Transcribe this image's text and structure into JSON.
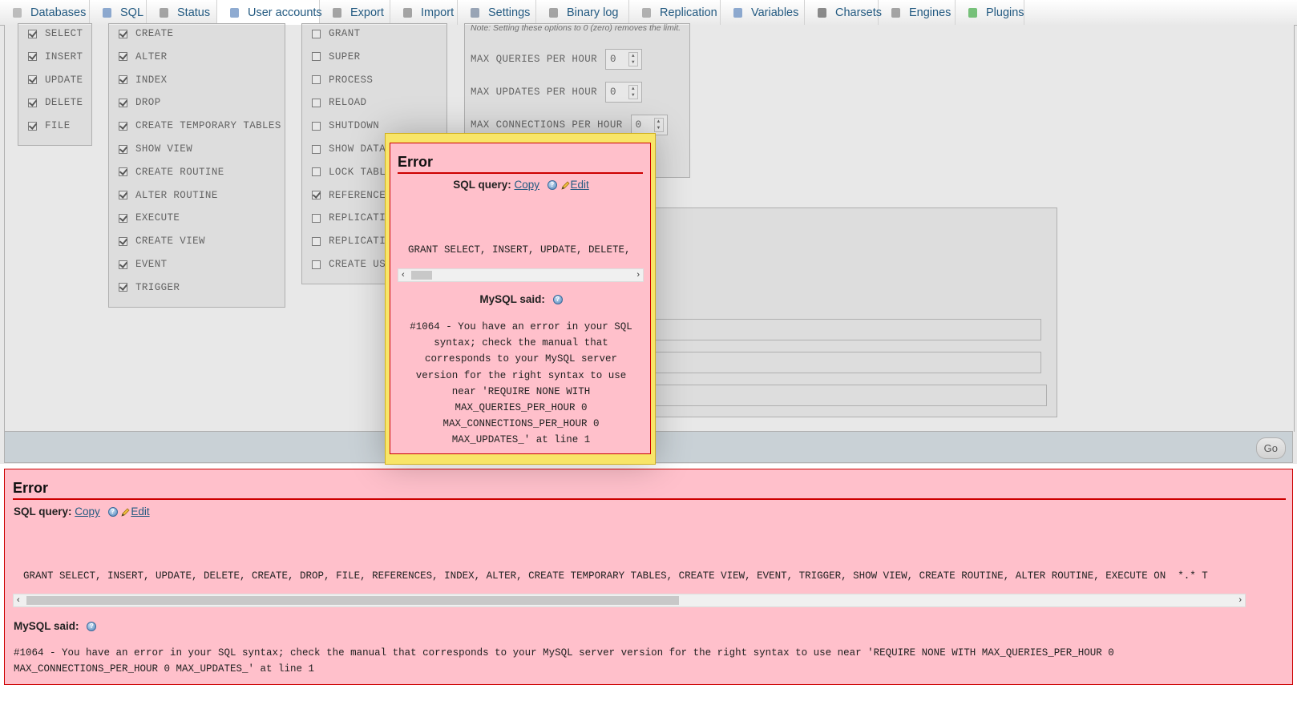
{
  "tabs": [
    {
      "label": "Databases",
      "icon": "database-icon",
      "active": false
    },
    {
      "label": "SQL",
      "icon": "sql-icon",
      "active": false
    },
    {
      "label": "Status",
      "icon": "status-icon",
      "active": false
    },
    {
      "label": "User accounts",
      "icon": "users-icon",
      "active": true
    },
    {
      "label": "Export",
      "icon": "export-icon",
      "active": false
    },
    {
      "label": "Import",
      "icon": "import-icon",
      "active": false
    },
    {
      "label": "Settings",
      "icon": "settings-icon",
      "active": false
    },
    {
      "label": "Binary log",
      "icon": "binary-log-icon",
      "active": false
    },
    {
      "label": "Replication",
      "icon": "replication-icon",
      "active": false
    },
    {
      "label": "Variables",
      "icon": "variables-icon",
      "active": false
    },
    {
      "label": "Charsets",
      "icon": "charsets-icon",
      "active": false
    },
    {
      "label": "Engines",
      "icon": "engines-icon",
      "active": false
    },
    {
      "label": "Plugins",
      "icon": "plugins-icon",
      "active": false
    }
  ],
  "privileges": {
    "data": [
      {
        "label": "SELECT",
        "checked": true
      },
      {
        "label": "INSERT",
        "checked": true
      },
      {
        "label": "UPDATE",
        "checked": true
      },
      {
        "label": "DELETE",
        "checked": true
      },
      {
        "label": "FILE",
        "checked": true
      }
    ],
    "structure": [
      {
        "label": "CREATE",
        "checked": true
      },
      {
        "label": "ALTER",
        "checked": true
      },
      {
        "label": "INDEX",
        "checked": true
      },
      {
        "label": "DROP",
        "checked": true
      },
      {
        "label": "CREATE TEMPORARY TABLES",
        "checked": true
      },
      {
        "label": "SHOW VIEW",
        "checked": true
      },
      {
        "label": "CREATE ROUTINE",
        "checked": true
      },
      {
        "label": "ALTER ROUTINE",
        "checked": true
      },
      {
        "label": "EXECUTE",
        "checked": true
      },
      {
        "label": "CREATE VIEW",
        "checked": true
      },
      {
        "label": "EVENT",
        "checked": true
      },
      {
        "label": "TRIGGER",
        "checked": true
      }
    ],
    "administration": [
      {
        "label": "GRANT",
        "checked": false
      },
      {
        "label": "SUPER",
        "checked": false
      },
      {
        "label": "PROCESS",
        "checked": false
      },
      {
        "label": "RELOAD",
        "checked": false
      },
      {
        "label": "SHUTDOWN",
        "checked": false
      },
      {
        "label": "SHOW DATA",
        "checked": false
      },
      {
        "label": "LOCK TABL",
        "checked": false
      },
      {
        "label": "REFERENCE",
        "checked": true
      },
      {
        "label": "REPLICATI",
        "checked": false
      },
      {
        "label": "REPLICATI",
        "checked": false
      },
      {
        "label": "CREATE US",
        "checked": false
      }
    ]
  },
  "limits": {
    "note": "Note: Setting these options to 0 (zero) removes the limit.",
    "rows": [
      {
        "label": "MAX QUERIES PER HOUR",
        "value": "0"
      },
      {
        "label": "MAX UPDATES PER HOUR",
        "value": "0"
      },
      {
        "label": "MAX CONNECTIONS PER HOUR",
        "value": "0"
      }
    ]
  },
  "footer": {
    "go_label": "Go"
  },
  "modal_error": {
    "title": "Error",
    "sql_query_label": "SQL query:",
    "copy_label": "Copy",
    "edit_label": "Edit",
    "query_text": "GRANT SELECT, INSERT, UPDATE, DELETE,",
    "mysql_said_label": "MySQL said:",
    "message_lines": [
      "#1064 - You have an error in your SQL",
      "syntax; check the manual that",
      "corresponds to your MySQL server",
      "version for the right syntax to use",
      "near 'REQUIRE NONE WITH",
      "MAX_QUERIES_PER_HOUR 0",
      "MAX_CONNECTIONS_PER_HOUR 0",
      "MAX_UPDATES_' at line 1"
    ]
  },
  "page_error": {
    "title": "Error",
    "sql_query_label": "SQL query:",
    "copy_label": "Copy",
    "edit_label": "Edit",
    "query_text": "GRANT SELECT, INSERT, UPDATE, DELETE, CREATE, DROP, FILE, REFERENCES, INDEX, ALTER, CREATE TEMPORARY TABLES, CREATE VIEW, EVENT, TRIGGER, SHOW VIEW, CREATE ROUTINE, ALTER ROUTINE, EXECUTE ON  *.* T",
    "mysql_said_label": "MySQL said:",
    "message_lines": [
      "#1064 - You have an error in your SQL syntax; check the manual that corresponds to your MySQL server version for the right syntax to use near 'REQUIRE NONE WITH MAX_QUERIES_PER_HOUR 0",
      "MAX_CONNECTIONS_PER_HOUR 0 MAX_UPDATES_' at line 1"
    ]
  }
}
